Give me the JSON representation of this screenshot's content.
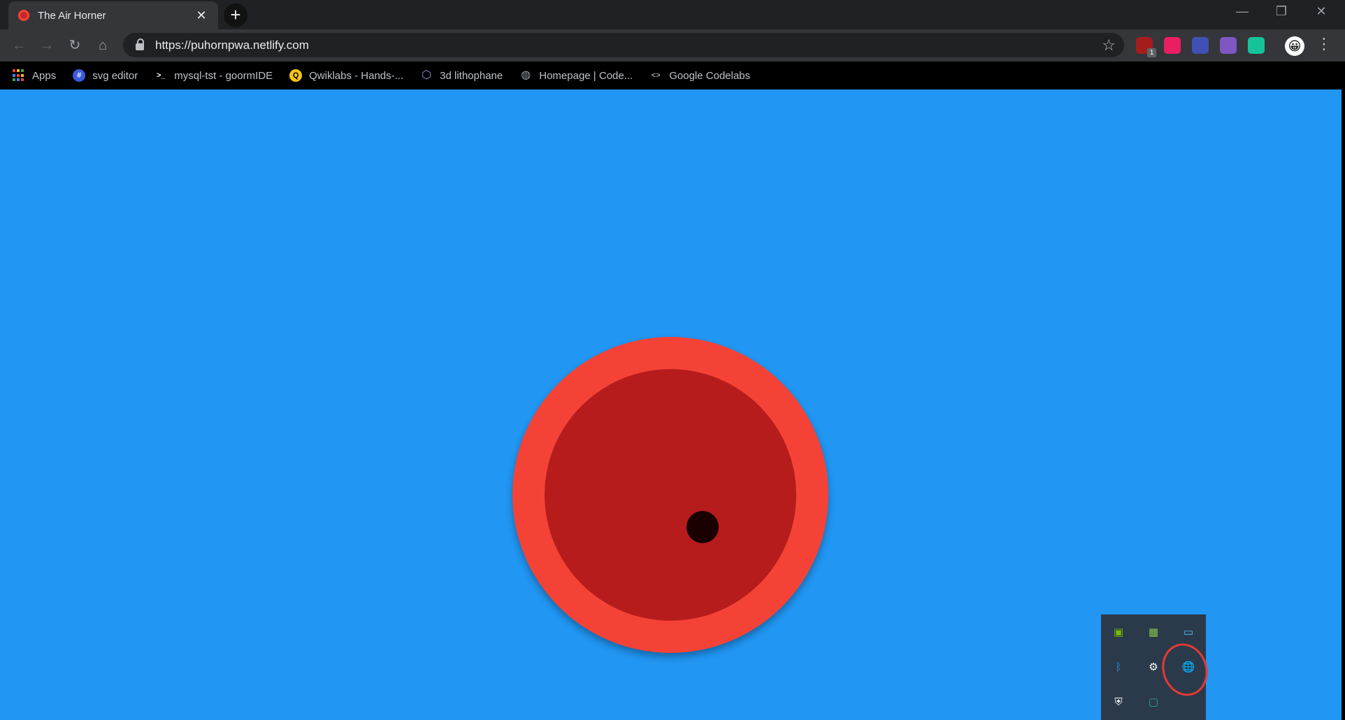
{
  "browser": {
    "tab_title": "The Air Horner",
    "tab_close": "✕",
    "new_tab": "+",
    "window_controls": {
      "minimize": "—",
      "restore": "❐",
      "close": "✕"
    },
    "url": "https://puhornpwa.netlify.com",
    "nav": {
      "back": "←",
      "forward": "→",
      "reload": "↻",
      "home": "⌂"
    },
    "star": "☆",
    "extensions": [
      {
        "name": "ublock-origin-icon",
        "badge": "1",
        "color": "#a51c1c"
      },
      {
        "name": "extension-pink-icon",
        "color": "#e91e63"
      },
      {
        "name": "extension-stripes-icon",
        "color": "#3f51b5"
      },
      {
        "name": "extension-glasses-icon",
        "color": "#7e57c2"
      },
      {
        "name": "grammarly-icon",
        "color": "#15c39a"
      }
    ],
    "avatar_glyph": "😀",
    "menu": "⋮"
  },
  "bookmarks": [
    {
      "label": "Apps",
      "icon": "apps-grid-icon"
    },
    {
      "label": "svg editor",
      "icon": "svg-editor-icon",
      "glyph": "#",
      "color": "#3b5bdb"
    },
    {
      "label": "mysql-tst - goormIDE",
      "icon": "terminal-icon",
      "glyph": ">_",
      "color": "#000000"
    },
    {
      "label": "Qwiklabs - Hands-...",
      "icon": "qwiklabs-icon",
      "glyph": "Q",
      "color": "#f5c518"
    },
    {
      "label": "3d lithophane",
      "icon": "lithophane-icon",
      "glyph": "⬡",
      "color": "#8e8ecf"
    },
    {
      "label": "Homepage | Code...",
      "icon": "globe-icon",
      "glyph": "◍",
      "color": "#5f6368"
    },
    {
      "label": "Google Codelabs",
      "icon": "codelabs-icon",
      "glyph": "<>",
      "color": "#000000"
    }
  ],
  "colors": {
    "page_background": "#2196f3",
    "horn_outer": "#f44336",
    "horn_inner": "#b71c1c",
    "horn_center": "#1a0000",
    "annotation": "#e53935"
  },
  "tray": [
    {
      "name": "nvidia-icon",
      "glyph": "▣",
      "color": "#76b900"
    },
    {
      "name": "task-manager-icon",
      "glyph": "▦",
      "color": "#8bc34a"
    },
    {
      "name": "monitor-icon",
      "glyph": "▭",
      "color": "#4fc3f7"
    },
    {
      "name": "bluetooth-icon",
      "glyph": "ᛒ",
      "color": "#2196f3"
    },
    {
      "name": "settings-gear-icon",
      "glyph": "⚙",
      "color": "#ffffff"
    },
    {
      "name": "network-globe-icon",
      "glyph": "🌐",
      "color": "#ffffff"
    },
    {
      "name": "windows-security-icon",
      "glyph": "⛨",
      "color": "#ffffff"
    },
    {
      "name": "app-tray-icon",
      "glyph": "▢",
      "color": "#26a69a"
    }
  ]
}
